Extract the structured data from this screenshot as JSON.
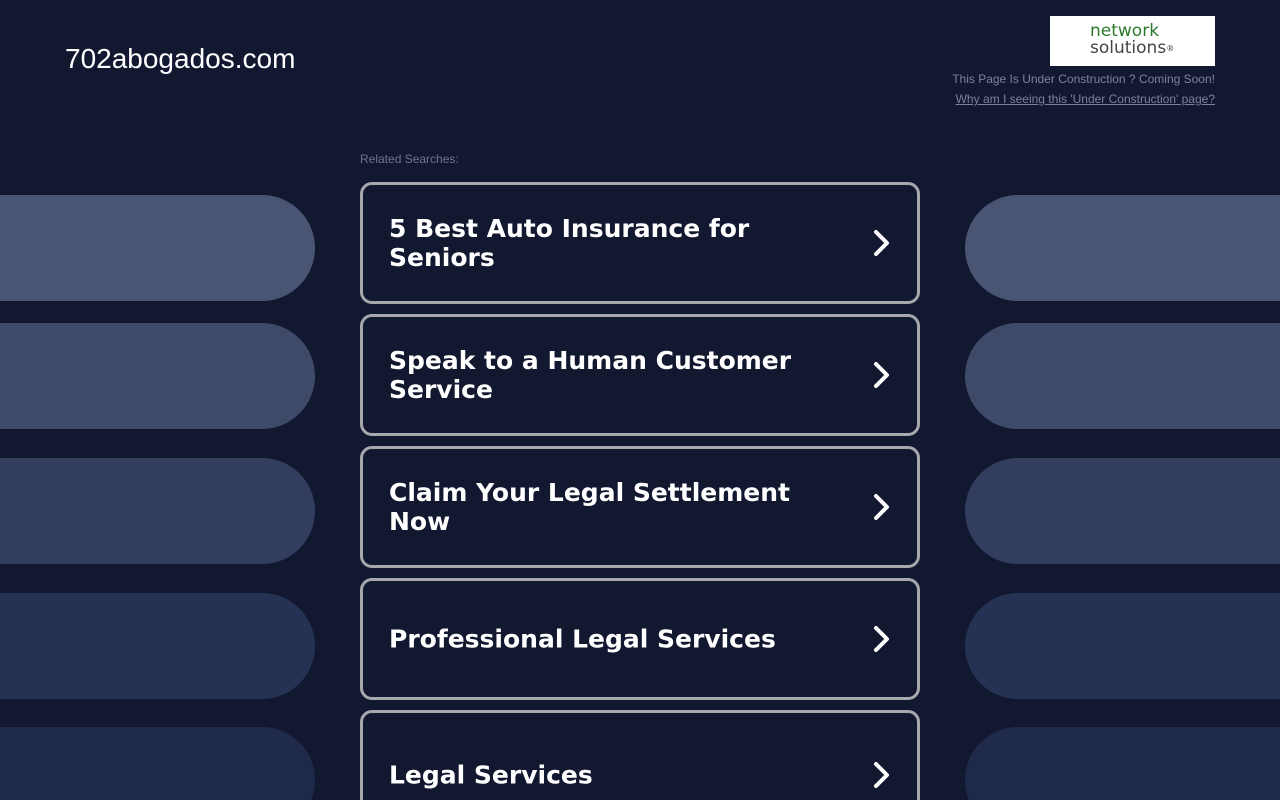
{
  "header": {
    "domain": "702abogados.com",
    "logo": {
      "line1": "network",
      "line2": "solutions",
      "registered_mark": "®",
      "brand_green": "#2b7a2e"
    },
    "construction_text": "This Page Is Under Construction ? Coming Soon!",
    "why_link": "Why am I seeing this 'Under Construction' page?"
  },
  "related": {
    "label": "Related Searches:",
    "items": [
      {
        "label": "5 Best Auto Insurance for Seniors",
        "icon": "chevron-right-icon"
      },
      {
        "label": "Speak to a Human Customer Service",
        "icon": "chevron-right-icon"
      },
      {
        "label": "Claim Your Legal Settlement Now",
        "icon": "chevron-right-icon"
      },
      {
        "label": "Professional Legal Services",
        "icon": "chevron-right-icon"
      },
      {
        "label": "Legal Services",
        "icon": "chevron-right-icon"
      }
    ]
  },
  "colors": {
    "background": "#121830",
    "card_border": "#a6a8ad",
    "text": "#ffffff",
    "muted_text": "#7b839a"
  }
}
